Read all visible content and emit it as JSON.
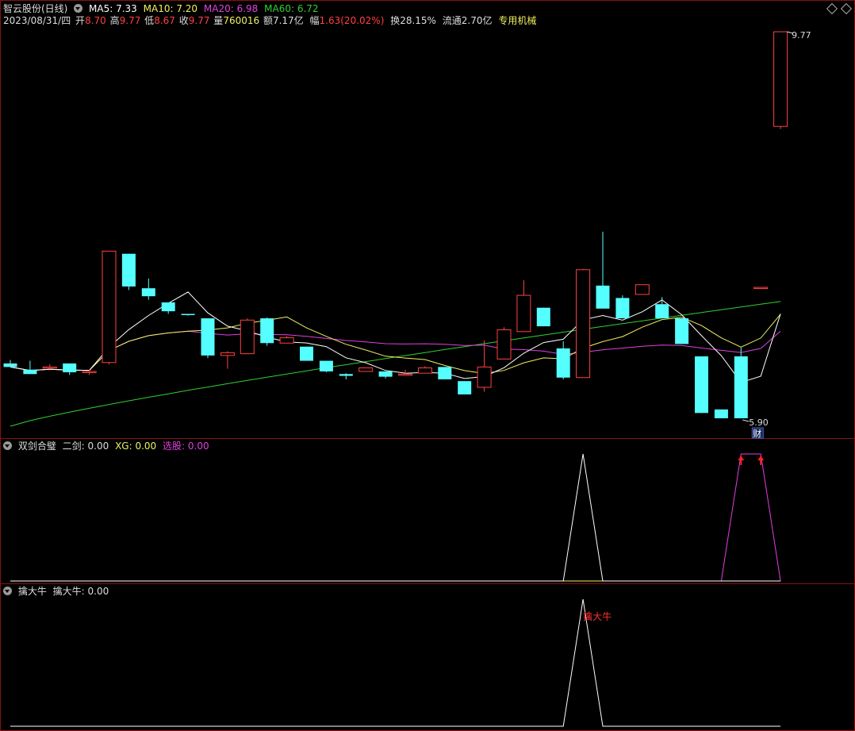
{
  "header": {
    "stock_title": "智云股份(日线)",
    "ma5": "MA5: 7.33",
    "ma10": "MA10: 7.20",
    "ma20": "MA20: 6.98",
    "ma60": "MA60: 6.72",
    "date": "2023/08/31/四",
    "open_label": "开",
    "open": "8.70",
    "high_label": "高",
    "high": "9.77",
    "low_label": "低",
    "low": "8.67",
    "close_label": "收",
    "close": "9.77",
    "vol_label": "量",
    "vol": "760016",
    "amount": "额7.17亿",
    "change_label": "幅",
    "change": "1.63(20.02%)",
    "turnover": "换28.15%",
    "float": "流通2.70亿",
    "sector": "专用机械",
    "colors": {
      "ma5": "#ffffff",
      "ma10": "#f0f060",
      "ma20": "#e040e0",
      "ma60": "#30d030",
      "up": "#ff4040",
      "down": "#55ffff"
    }
  },
  "panel2": {
    "name": "双剑合璧",
    "v1": "二剑: 0.00",
    "v2": "XG: 0.00",
    "v3_label": "选股: ",
    "v3": "0.00"
  },
  "panel3": {
    "name": "擒大牛",
    "v1": "擒大牛: 0.00",
    "annotation": "擒大牛"
  },
  "chart_data": [
    {
      "type": "candlestick",
      "title": "智云股份(日线)",
      "price_labels": {
        "max": "9.77",
        "min": "5.90",
        "marker": "财"
      },
      "ohlc": [
        [
          6.02,
          6.06,
          5.98,
          5.98
        ],
        [
          5.95,
          6.05,
          5.95,
          5.9
        ],
        [
          5.97,
          6.01,
          5.94,
          5.98
        ],
        [
          6.02,
          6.02,
          5.89,
          5.92
        ],
        [
          5.93,
          5.95,
          5.89,
          5.93
        ],
        [
          6.03,
          7.29,
          6.01,
          7.29
        ],
        [
          7.26,
          7.26,
          6.85,
          6.89
        ],
        [
          6.87,
          6.98,
          6.74,
          6.78
        ],
        [
          6.71,
          6.71,
          6.58,
          6.61
        ],
        [
          6.58,
          6.58,
          6.56,
          6.57
        ],
        [
          6.53,
          6.53,
          6.08,
          6.11
        ],
        [
          6.11,
          6.16,
          5.96,
          6.14
        ],
        [
          6.13,
          6.53,
          6.13,
          6.51
        ],
        [
          6.53,
          6.54,
          6.22,
          6.25
        ],
        [
          6.25,
          6.33,
          6.26,
          6.31
        ],
        [
          6.21,
          6.21,
          6.05,
          6.05
        ],
        [
          6.05,
          6.05,
          5.92,
          5.93
        ],
        [
          5.9,
          5.91,
          5.84,
          5.88
        ],
        [
          5.93,
          5.96,
          5.93,
          5.97
        ],
        [
          5.93,
          5.93,
          5.85,
          5.87
        ],
        [
          5.89,
          5.95,
          5.89,
          5.9
        ],
        [
          5.91,
          5.99,
          5.91,
          5.97
        ],
        [
          5.98,
          5.98,
          5.84,
          5.84
        ],
        [
          5.82,
          5.82,
          5.67,
          5.67
        ],
        [
          5.75,
          6.28,
          5.7,
          5.98
        ],
        [
          6.07,
          6.43,
          6.07,
          6.4
        ],
        [
          6.38,
          6.96,
          6.38,
          6.79
        ],
        [
          6.65,
          6.65,
          6.44,
          6.44
        ],
        [
          6.19,
          6.27,
          5.84,
          5.86
        ],
        [
          5.86,
          7.09,
          5.86,
          7.08
        ],
        [
          6.9,
          7.51,
          6.71,
          6.64
        ],
        [
          6.76,
          6.79,
          6.56,
          6.53
        ],
        [
          6.8,
          6.91,
          6.8,
          6.91
        ],
        [
          6.69,
          6.77,
          6.66,
          6.53
        ],
        [
          6.53,
          6.49,
          6.25,
          6.24
        ],
        [
          6.1,
          6.1,
          5.46,
          5.46
        ],
        [
          5.5,
          5.5,
          5.4,
          5.4
        ],
        [
          6.1,
          6.2,
          5.4,
          5.4
        ],
        [
          6.88,
          6.88,
          6.87,
          6.88
        ],
        [
          8.7,
          9.77,
          8.67,
          9.77
        ]
      ]
    },
    {
      "type": "line",
      "title": "双剑合璧",
      "series": [
        {
          "name": "二剑",
          "values": [
            0,
            0,
            0,
            0,
            0,
            0,
            0,
            0,
            0,
            0,
            0,
            0,
            0,
            0,
            0,
            0,
            0,
            0,
            0,
            0,
            0,
            0,
            0,
            0,
            0,
            0,
            0,
            0,
            0,
            1,
            0,
            0,
            0,
            0,
            0,
            0,
            0,
            0,
            0,
            0
          ]
        },
        {
          "name": "XG",
          "values": [
            0,
            0,
            0,
            0,
            0,
            0,
            0,
            0,
            0,
            0,
            0,
            0,
            0,
            0,
            0,
            0,
            0,
            0,
            0,
            0,
            0,
            0,
            0,
            0,
            0,
            0,
            0,
            0,
            0,
            0,
            0,
            0,
            0,
            0,
            0,
            0,
            0,
            0,
            0,
            0
          ]
        },
        {
          "name": "选股",
          "values": [
            0,
            0,
            0,
            0,
            0,
            0,
            0,
            0,
            0,
            0,
            0,
            0,
            0,
            0,
            0,
            0,
            0,
            0,
            0,
            0,
            0,
            0,
            0,
            0,
            0,
            0,
            0,
            0,
            0,
            0,
            0,
            0,
            0,
            0,
            0,
            0,
            0,
            1,
            1,
            0
          ]
        }
      ],
      "ylim": [
        0,
        1
      ]
    },
    {
      "type": "line",
      "title": "擒大牛",
      "series": [
        {
          "name": "擒大牛",
          "values": [
            0,
            0,
            0,
            0,
            0,
            0,
            0,
            0,
            0,
            0,
            0,
            0,
            0,
            0,
            0,
            0,
            0,
            0,
            0,
            0,
            0,
            0,
            0,
            0,
            0,
            0,
            0,
            0,
            0,
            1,
            0,
            0,
            0,
            0,
            0,
            0,
            0,
            0,
            0,
            0
          ]
        }
      ],
      "ylim": [
        0,
        1
      ]
    }
  ]
}
